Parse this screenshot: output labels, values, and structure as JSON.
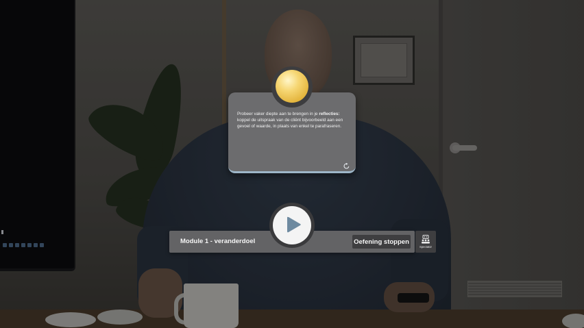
{
  "feedback": {
    "text_before": "Probeer vaker diepte aan te brengen in je ",
    "text_bold": "reflecties:",
    "text_after": " koppel de uitspraak van de cliënt bijvoorbeeld aan een gevoel of waarde, in plaats van enkel te parafraseren."
  },
  "controls": {
    "module_title": "Module 1 - veranderdoel",
    "stop_label": "Oefening stoppen",
    "spectator_label": "Spectator"
  },
  "icons": {
    "score": "coin-icon",
    "refresh": "refresh-icon",
    "play": "play-icon",
    "spectator": "spectator-icon"
  },
  "colors": {
    "accent_blue": "#9db6c8",
    "play_icon": "#6e8aa0",
    "coin": "#f6d673",
    "card_bg": "#6c6c6e",
    "bar_bg": "#636365"
  }
}
